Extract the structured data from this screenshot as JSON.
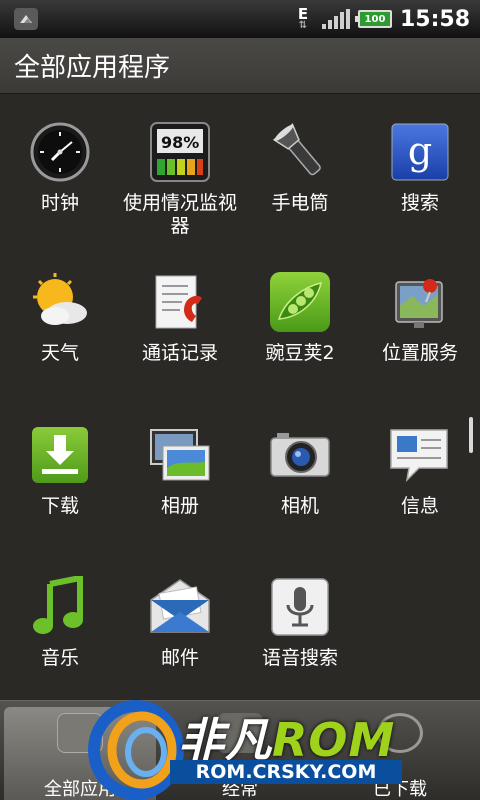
{
  "status_bar": {
    "network": "E",
    "battery": "100",
    "time": "15:58"
  },
  "header": {
    "title": "全部应用程序"
  },
  "apps": [
    {
      "label": "时钟",
      "icon": "clock-icon"
    },
    {
      "label": "使用情况监视器",
      "icon": "usage-monitor-icon",
      "icon_text": "98%"
    },
    {
      "label": "手电筒",
      "icon": "flashlight-icon"
    },
    {
      "label": "搜索",
      "icon": "google-search-icon",
      "icon_text": "g"
    },
    {
      "label": "天气",
      "icon": "weather-icon"
    },
    {
      "label": "通话记录",
      "icon": "call-log-icon"
    },
    {
      "label": "豌豆荚2",
      "icon": "wandoujia-icon"
    },
    {
      "label": "位置服务",
      "icon": "location-service-icon"
    },
    {
      "label": "下载",
      "icon": "download-icon"
    },
    {
      "label": "相册",
      "icon": "gallery-icon"
    },
    {
      "label": "相机",
      "icon": "camera-icon"
    },
    {
      "label": "信息",
      "icon": "messages-icon"
    },
    {
      "label": "音乐",
      "icon": "music-icon"
    },
    {
      "label": "邮件",
      "icon": "mail-icon"
    },
    {
      "label": "语音搜索",
      "icon": "voice-search-icon"
    }
  ],
  "tabs": [
    {
      "label": "全部应用",
      "active": true
    },
    {
      "label": "经常",
      "active": false
    },
    {
      "label": "已下载",
      "active": false
    }
  ],
  "watermark": {
    "brand_a": "非凡",
    "brand_b": "ROM",
    "url": "ROM.CRSKY.COM"
  }
}
